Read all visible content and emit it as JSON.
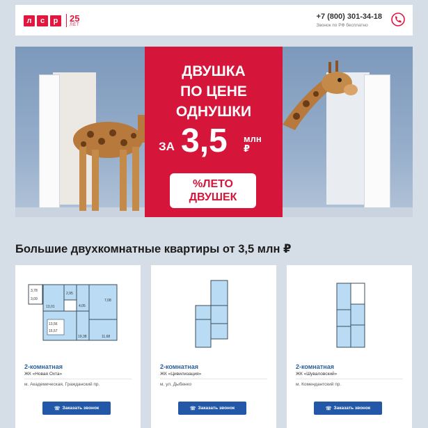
{
  "header": {
    "logo_letters": [
      "л",
      "с",
      "р"
    ],
    "logo_years": "25",
    "logo_years_unit": "ЛЕТ",
    "phone": "+7 (800) 301-34-18",
    "phone_note": "Звонок по РФ бесплатно",
    "phone_icon": "callback-phone-icon"
  },
  "banner": {
    "title_lines": [
      "ДВУШКА",
      "ПО ЦЕНЕ",
      "ОДНУШКИ"
    ],
    "price_prefix": "ЗА",
    "price_value": "3,5",
    "price_unit_1": "млн",
    "price_unit_2": "₽",
    "promo_line_1": "%ЛЕТО",
    "promo_line_2": "ДВУШЕК"
  },
  "section_title": "Большие двухкомнатные квартиры от 3,5 млн ₽",
  "cards": [
    {
      "type": "2-комнатная",
      "complex": "ЖК «Новая Охта»",
      "address": "м. Академическая, Гражданский пр.",
      "button": "Заказать звонок",
      "plan_labels": [
        "3,78",
        "3,09",
        "13,01",
        "7,08",
        "2,95",
        "4,05",
        "13,56",
        "15,57",
        "19,38",
        "11,68"
      ]
    },
    {
      "type": "2-комнатная",
      "complex": "ЖК «Цивилизация»",
      "address": "м. ул. Дыбенко",
      "button": "Заказать звонок"
    },
    {
      "type": "2-комнатная",
      "complex": "ЖК «Шуваловский»",
      "address": "м. Комендантский пр.",
      "button": "Заказать звонок"
    }
  ],
  "colors": {
    "brand_red": "#d5153a",
    "button_blue": "#2358a8",
    "plan_blue": "#b9dcf4",
    "page_bg": "#d5dde7"
  }
}
